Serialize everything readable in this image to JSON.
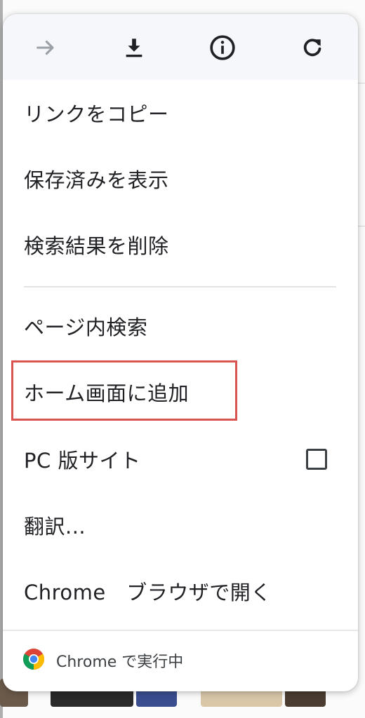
{
  "toolbar": {
    "forward_icon": "arrow-right-icon",
    "download_icon": "download-icon",
    "info_icon": "info-icon",
    "reload_icon": "reload-icon"
  },
  "menu": {
    "items": [
      {
        "label": "リンクをコピー"
      },
      {
        "label": "保存済みを表示"
      },
      {
        "label": "検索結果を削除"
      },
      {
        "label": "ページ内検索"
      },
      {
        "label": "ホーム画面に追加"
      },
      {
        "label": "PC 版サイト",
        "checked": false
      },
      {
        "label": "翻訳..."
      },
      {
        "label": "Chrome　ブラウザで開く"
      }
    ],
    "footer": {
      "label": "Chrome で実行中"
    }
  },
  "colors": {
    "highlight": "#d9534f",
    "toolbar_bg": "#f5f7fb",
    "text": "#202124"
  }
}
